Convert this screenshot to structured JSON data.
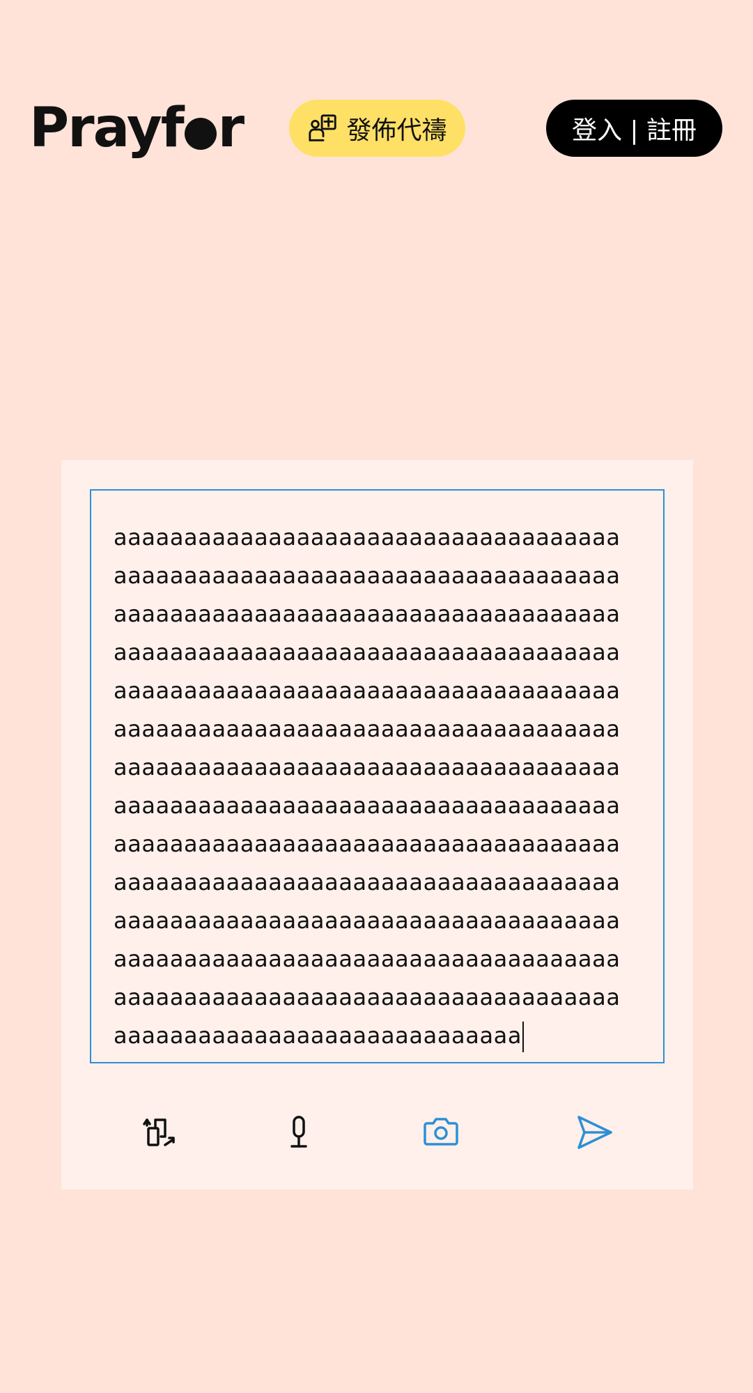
{
  "header": {
    "logo_text_left": "Pray",
    "logo_text_f": "f",
    "logo_text_right": "r",
    "post_button_label": "發佈代禱",
    "login_button_label": "登入 | 註冊"
  },
  "editor": {
    "lines": [
      "aaaaaaaaaaaaaaaaaaaaaaaaaaaaaaaaaaaa",
      "aaaaaaaaaaaaaaaaaaaaaaaaaaaaaaaaaaaa",
      "aaaaaaaaaaaaaaaaaaaaaaaaaaaaaaaaaaaa",
      "aaaaaaaaaaaaaaaaaaaaaaaaaaaaaaaaaaaa",
      "aaaaaaaaaaaaaaaaaaaaaaaaaaaaaaaaaaaa",
      "aaaaaaaaaaaaaaaaaaaaaaaaaaaaaaaaaaaa",
      "aaaaaaaaaaaaaaaaaaaaaaaaaaaaaaaaaaaa",
      "aaaaaaaaaaaaaaaaaaaaaaaaaaaaaaaaaaaa",
      "aaaaaaaaaaaaaaaaaaaaaaaaaaaaaaaaaaaa",
      "aaaaaaaaaaaaaaaaaaaaaaaaaaaaaaaaaaaa",
      "aaaaaaaaaaaaaaaaaaaaaaaaaaaaaaaaaaaa",
      "aaaaaaaaaaaaaaaaaaaaaaaaaaaaaaaaaaaa",
      "aaaaaaaaaaaaaaaaaaaaaaaaaaaaaaaaaaaa",
      "aaaaaaaaaaaaaaaaaaaaaaaaaaaaa"
    ]
  },
  "toolbar": {
    "icons": [
      "switch-device-icon",
      "microphone-icon",
      "camera-icon",
      "send-icon"
    ]
  },
  "colors": {
    "background": "#ffe3d9",
    "card": "#fff0eb",
    "accent_blue": "#2d8fd5",
    "post_button": "#ffe066",
    "login_button": "#000000"
  }
}
